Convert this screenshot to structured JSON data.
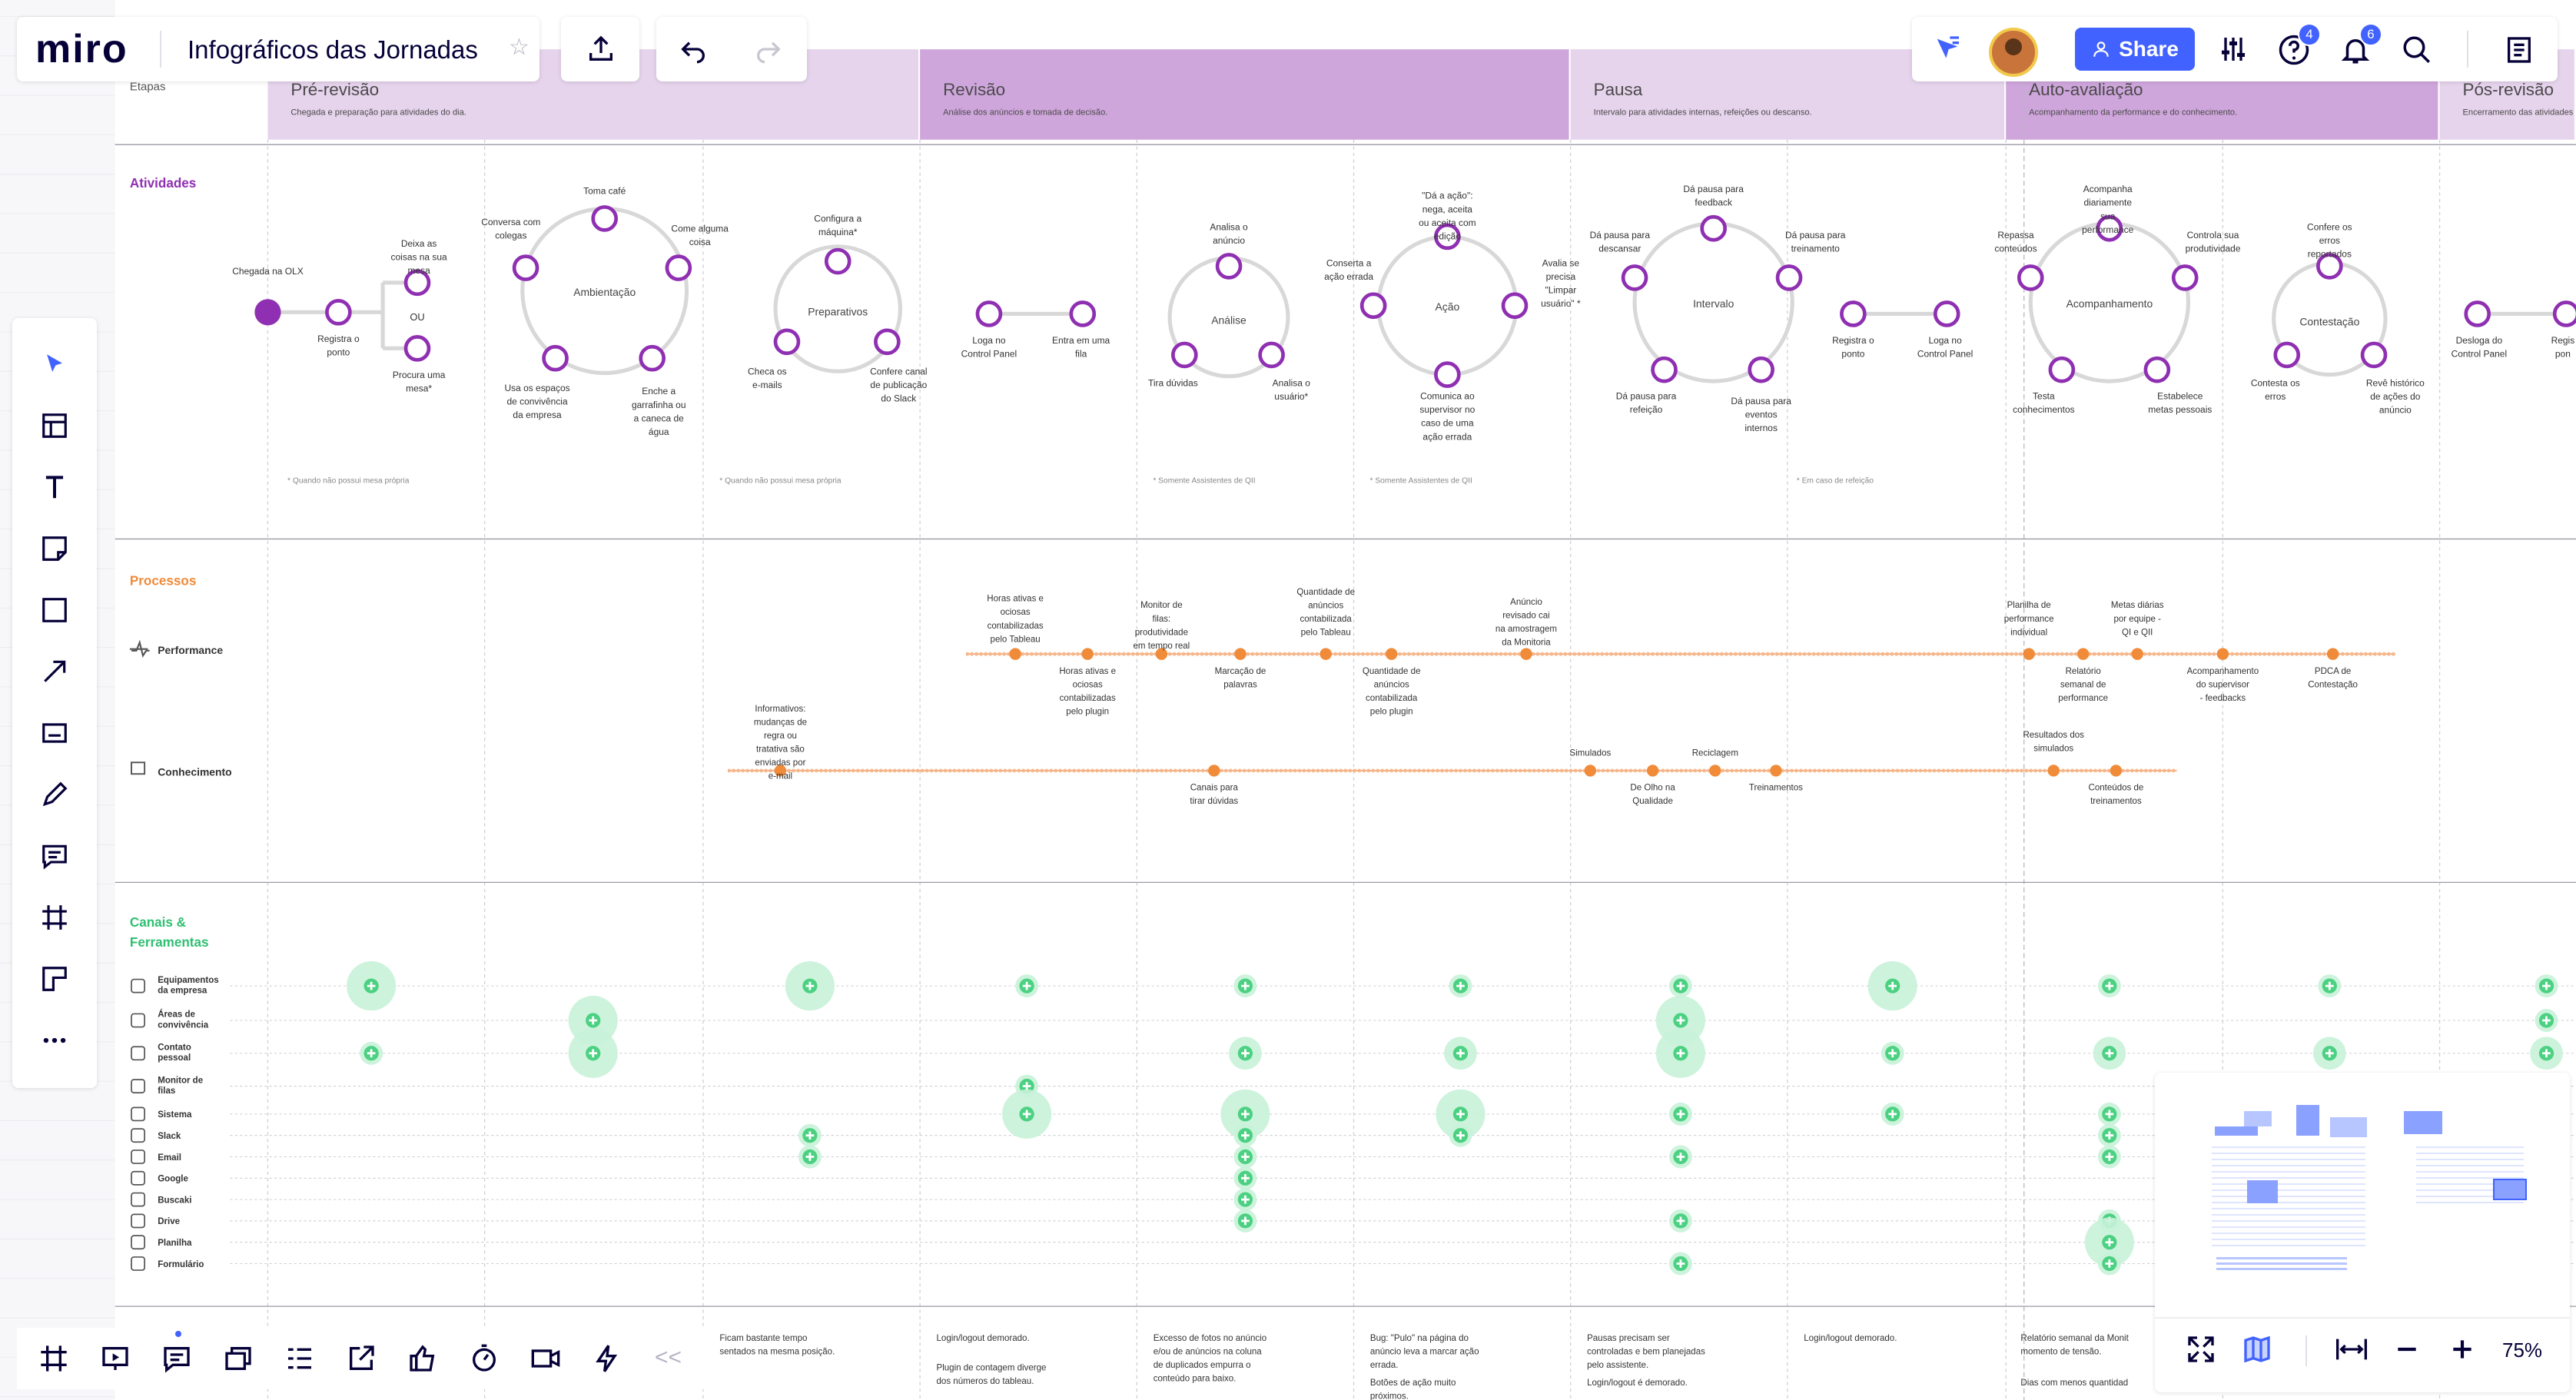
{
  "app": {
    "logo": "miro",
    "board_title": "Infográficos das Jornadas",
    "share_label": "Share",
    "help_badge": "4",
    "notif_badge": "6",
    "zoom": "75%",
    "collapse_label": "<<"
  },
  "colors": {
    "accent": "#4262ff",
    "purple": "#8f2fb2",
    "purple_light": "#e6d3ec",
    "purple_mid": "#cfa6dc",
    "orange": "#f08b3a",
    "green": "#4cd182",
    "green_light": "#c8f2d8",
    "activity_label": "#8f2fb2",
    "process_label": "#f08b3a",
    "channel_label": "#2fbf71"
  },
  "stages": [
    {
      "title": "Pré-revisão",
      "desc": "Chegada e preparação para atividades do dia."
    },
    {
      "title": "Revisão",
      "desc": "Análise dos anúncios e tomada de decisão."
    },
    {
      "title": "Pausa",
      "desc": "Intervalo para atividades internas, refeições ou descanso."
    },
    {
      "title": "Auto-avaliação",
      "desc": "Acompanhamento da performance e do conhecimento."
    },
    {
      "title": "Pós-revisão",
      "desc": "Encerramento das atividades"
    }
  ],
  "row_labels": {
    "etapas": "Etapas",
    "atividades": "Atividades",
    "processos": "Processos",
    "performance": "Performance",
    "conhecimento": "Conhecimento",
    "canais1": "Canais &",
    "canais2": "Ferramentas"
  },
  "activity_notes": [
    "Chegada na OLX",
    "Registra o ponto",
    "OU",
    "Deixa as coisas na sua mesa",
    "Procura uma mesa*",
    "Ambientação",
    "Toma café",
    "Conversa com colegas",
    "Come alguma coisa",
    "Usa os espaços de convivência da empresa",
    "Enche a garrafinha ou a caneca de água",
    "Preparativos",
    "Configura a máquina*",
    "Checa os e-mails",
    "Confere canal de publicação do Slack",
    "Loga no Control Panel",
    "Entra em uma fila",
    "Análise",
    "Analisa o anúncio",
    "Tira dúvidas",
    "Analisa o usuário*",
    "Ação",
    "\"Dá a ação\": nega, aceita ou aceita com edição",
    "Conserta a ação errada",
    "Avalia se precisa \"Limpar usuário\" *",
    "Comunica ao supervisor no caso de uma ação errada",
    "Intervalo",
    "Dá pausa para feedback",
    "Dá pausa para descansar",
    "Dá pausa para treinamento",
    "Dá pausa para refeição",
    "Dá pausa para eventos internos",
    "Registra o ponto",
    "Loga no Control Panel",
    "Acompanhamento",
    "Acompanha diariamente sua performance",
    "Repassa conteúdos",
    "Controla sua produtividade",
    "Testa conhecimentos",
    "Estabelece metas pessoais",
    "Contestação",
    "Confere os erros reportados",
    "Contesta os erros",
    "Revê histórico de ações do anúncio",
    "Desloga do Control Panel",
    "Regis pon"
  ],
  "footnotes": [
    "* Quando não possui mesa própria",
    "* Quando não possui mesa própria",
    "* Somente Assistentes de QII",
    "* Somente Assistentes de QII",
    "* Em caso de refeição"
  ],
  "performance_notes": [
    "Horas ativas e ociosas contabilizadas pelo Tableau",
    "Horas ativas e ociosas contabilizadas pelo plugin",
    "Monitor de filas: produtividade em tempo real",
    "Marcação de palavras",
    "Quantidade de anúncios contabilizada pelo Tableau",
    "Quantidade de anúncios contabilizada pelo plugin",
    "Anúncio revisado cai na amostragem da Monitoria",
    "Planilha de performance individual",
    "Relatório semanal de performance",
    "Metas diárias por equipe - QI e QII",
    "Acompanhamento do supervisor - feedbacks",
    "PDCA de Contestação"
  ],
  "knowledge_notes": [
    "Informativos: mudanças de regra ou tratativa são enviadas por e-mail",
    "Canais para tirar dúvidas",
    "Simulados",
    "De Olho na Qualidade",
    "Reciclagem",
    "Treinamentos",
    "Resultados dos simulados",
    "Conteúdos de treinamentos"
  ],
  "channels": [
    "Equipamentos da empresa",
    "Áreas de convivência",
    "Contato pessoal",
    "Monitor de filas",
    "Sistema",
    "Slack",
    "Email",
    "Google",
    "Buscaki",
    "Drive",
    "Planilha",
    "Formulário"
  ],
  "pain_points": [
    "Ficam bastante tempo sentados na mesma posição.",
    "Login/logout demorado.",
    "Plugin de contagem diverge dos números do tableau.",
    "Excesso de fotos no anúncio e/ou de anúncios na coluna de duplicados empurra o conteúdo para baixo.",
    "Bug: \"Pulo\" na página do anúncio leva a marcar ação errada.",
    "Botões de ação muito próximos.",
    "Pausas precisam ser controladas e bem planejadas pelo assistente.",
    "Login/logout é demorado.",
    "Login/logout demorado.",
    "Relatório semanal da Monit momento de tensão.",
    "Dias com menos quantidad"
  ]
}
